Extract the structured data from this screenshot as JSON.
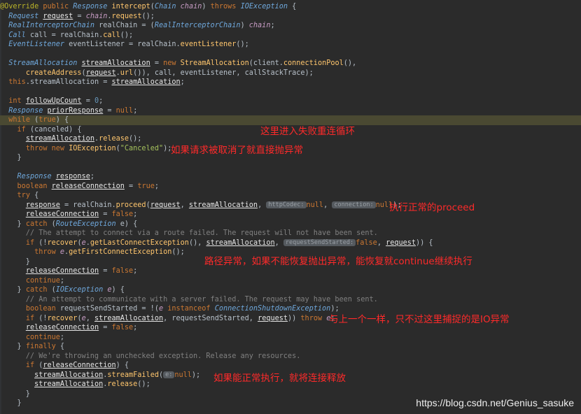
{
  "editor": {
    "lines": [
      "@Override public Response intercept(Chain chain) throws IOException {",
      "  Request request = chain.request();",
      "  RealInterceptorChain realChain = (RealInterceptorChain) chain;",
      "  Call call = realChain.call();",
      "  EventListener eventListener = realChain.eventListener();",
      "",
      "  StreamAllocation streamAllocation = new StreamAllocation(client.connectionPool(),",
      "      createAddress(request.url()), call, eventListener, callStackTrace);",
      "  this.streamAllocation = streamAllocation;",
      "",
      "  int followUpCount = 0;",
      "  Response priorResponse = null;",
      "  while (true) {",
      "    if (canceled) {",
      "      streamAllocation.release();",
      "      throw new IOException(\"Canceled\");",
      "    }",
      "",
      "    Response response;",
      "    boolean releaseConnection = true;",
      "    try {",
      "      response = realChain.proceed(request, streamAllocation, httpCodec: null, connection: null);",
      "      releaseConnection = false;",
      "    } catch (RouteException e) {",
      "      // The attempt to connect via a route failed. The request will not have been sent.",
      "      if (!recover(e.getLastConnectException(), streamAllocation, requestSendStarted: false, request)) {",
      "        throw e.getFirstConnectException();",
      "      }",
      "      releaseConnection = false;",
      "      continue;",
      "    } catch (IOException e) {",
      "      // An attempt to communicate with a server failed. The request may have been sent.",
      "      boolean requestSendStarted = !(e instanceof ConnectionShutdownException);",
      "      if (!recover(e, streamAllocation, requestSendStarted, request)) throw e;",
      "      releaseConnection = false;",
      "      continue;",
      "    } finally {",
      "      // We're throwing an unchecked exception. Release any resources.",
      "      if (releaseConnection) {",
      "        streamAllocation.streamFailed(e: null);",
      "        streamAllocation.release();",
      "      }",
      "    }"
    ],
    "param_hints": {
      "http_codec": "httpCodec:",
      "connection": "connection:",
      "request_send_started": "requestSendStarted:",
      "e": "e:"
    }
  },
  "annotations": {
    "retry_loop": "这里进入失败重连循环",
    "canceled": "如果请求被取消了就直接抛异常",
    "proceed": "执行正常的proceed",
    "route_exception": "路径异常，如果不能恢复抛出异常，能恢复就continue继续执行",
    "io_exception": "与上一个一样，只不过这里捕捉的是IO异常",
    "finally_release": "如果能正常执行，就将连接释放"
  },
  "watermark": "https://blog.csdn.net/Genius_sasuke",
  "colors": {
    "background": "#2b2b2b",
    "keyword": "#cc7832",
    "annotation_text": "#ff2a2a",
    "current_line": "#3b3a32"
  }
}
